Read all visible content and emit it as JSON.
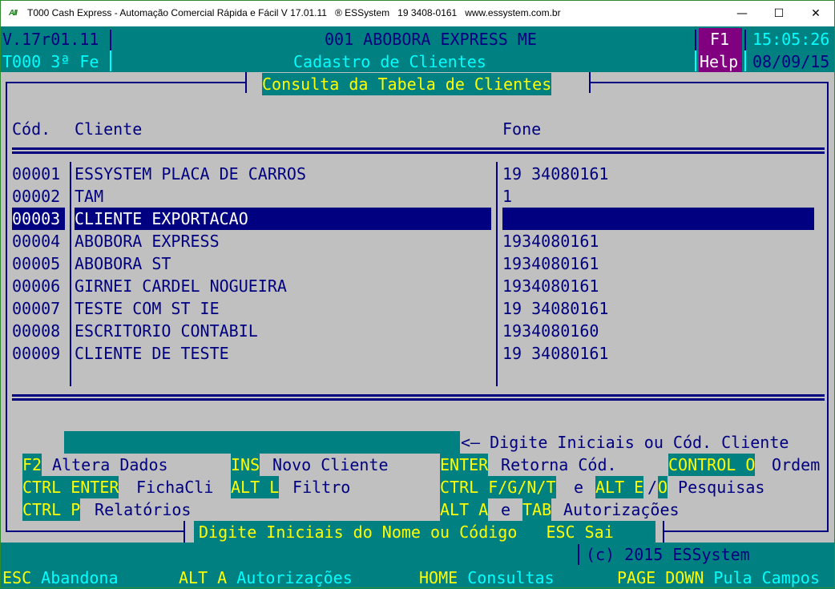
{
  "window": {
    "title": "T000 Cash Express - Automação Comercial Rápida e Fácil V 17.01.11   ® ESSystem   19 3408-0161   www.essystem.com.br",
    "app_icon_text": "AII",
    "controls": {
      "minimize": "—",
      "maximize": "☐",
      "close": "✕"
    }
  },
  "header": {
    "version": "V.17r01.11",
    "terminal": "T000 3ª Fe",
    "company": "001 ABOBORA EXPRESS ME",
    "screen_title": "Cadastro de Clientes",
    "help_key": "F1",
    "help_label": "Help",
    "time": "15:05:26",
    "date": "08/09/15"
  },
  "panel": {
    "title": "Consulta da Tabela de Clientes",
    "columns": {
      "code": "Cód.",
      "client": "Cliente",
      "phone": "Fone"
    },
    "rows": [
      {
        "code": "00001",
        "client": "ESSYSTEM PLACA DE CARROS",
        "phone": "19 34080161",
        "selected": false
      },
      {
        "code": "00002",
        "client": "TAM",
        "phone": "1",
        "selected": false
      },
      {
        "code": "00003",
        "client": "CLIENTE EXPORTACAO",
        "phone": "",
        "selected": true
      },
      {
        "code": "00004",
        "client": "ABOBORA EXPRESS",
        "phone": "1934080161",
        "selected": false
      },
      {
        "code": "00005",
        "client": "ABOBORA ST",
        "phone": "1934080161",
        "selected": false
      },
      {
        "code": "00006",
        "client": "GIRNEI CARDEL NOGUEIRA",
        "phone": "1934080161",
        "selected": false
      },
      {
        "code": "00007",
        "client": "TESTE COM ST IE",
        "phone": "19 34080161",
        "selected": false
      },
      {
        "code": "00008",
        "client": "ESCRITORIO CONTABIL",
        "phone": "1934080160",
        "selected": false
      },
      {
        "code": "00009",
        "client": "CLIENTE DE TESTE",
        "phone": "19 34080161",
        "selected": false
      }
    ],
    "search": {
      "value": "",
      "hint": "<— Digite Iniciais ou Cód. Cliente"
    },
    "shortcuts": {
      "f2_key": "F2",
      "f2_label": " Altera Dados",
      "ins_key": "INS",
      "ins_label": " Novo Cliente",
      "enter_key": "ENTER",
      "enter_label": " Retorna Cód.",
      "ctrlo_key": "CONTROL O",
      "ctrlo_label": " Ordem",
      "ctrlenter_key": "CTRL ENTER",
      "ctrlenter_label": " FichaCli",
      "altl_key": "ALT L",
      "altl_label": " Filtro",
      "ctrlf_key": "CTRL F/G/N/T",
      "ctrlf_sep": " e ",
      "alte_key": "ALT E",
      "alte_slash": "/",
      "alto_key": "O",
      "pesq_label": " Pesquisas",
      "ctrlp_key": "CTRL P",
      "ctrlp_label": " Relatórios",
      "alta_key": "ALT A",
      "alta_sep": " e ",
      "tab_key": "TAB",
      "auth_label": " Autorizações"
    },
    "footer_prompt": "Digite Iniciais do Nome ou Código   ESC Sai"
  },
  "status": {
    "copyright": "(c) 2015 ESSystem",
    "keys": [
      {
        "key": "ESC",
        "label": " Abandona"
      },
      {
        "key": "ALT A",
        "label": " Autorizações"
      },
      {
        "key": "HOME",
        "label": " Consultas"
      },
      {
        "key": "PAGE DOWN",
        "label": " Pula Campos"
      }
    ]
  },
  "colors": {
    "teal": "#008080",
    "navy": "#000080",
    "grey": "#c0c0c0",
    "yellow": "#ffff00",
    "cyan": "#00ffff",
    "purple": "#800080"
  }
}
